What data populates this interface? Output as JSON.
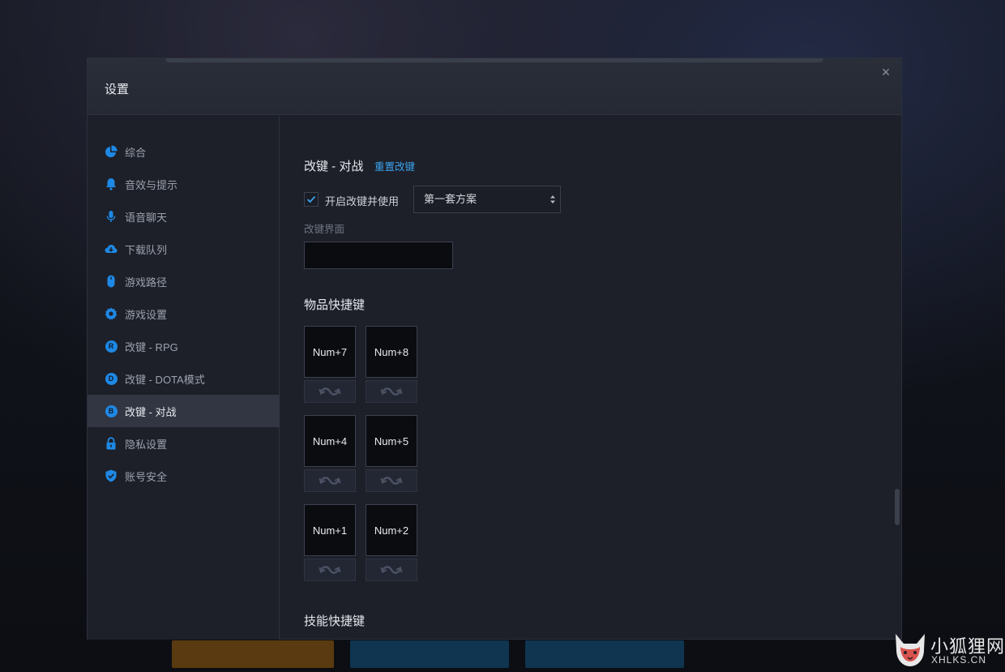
{
  "dialog": {
    "title": "设置",
    "close_label": "×"
  },
  "sidebar": {
    "items": [
      {
        "label": "综合",
        "icon": "pie-chart-icon"
      },
      {
        "label": "音效与提示",
        "icon": "bell-icon"
      },
      {
        "label": "语音聊天",
        "icon": "microphone-icon"
      },
      {
        "label": "下载队列",
        "icon": "cloud-download-icon"
      },
      {
        "label": "游戏路径",
        "icon": "mouse-icon"
      },
      {
        "label": "游戏设置",
        "icon": "gear-icon"
      },
      {
        "label": "改键 - RPG",
        "icon": "letter-r-icon",
        "badge": "R"
      },
      {
        "label": "改键 - DOTA模式",
        "icon": "letter-d-icon",
        "badge": "D"
      },
      {
        "label": "改键 - 对战",
        "icon": "letter-b-icon",
        "badge": "B",
        "active": true
      },
      {
        "label": "隐私设置",
        "icon": "lock-icon"
      },
      {
        "label": "账号安全",
        "icon": "shield-icon"
      }
    ]
  },
  "content": {
    "section_title": "改键 - 对战",
    "reset_link": "重置改键",
    "enable_label": "开启改键并使用",
    "enable_checked": true,
    "scheme_selected": "第一套方案",
    "interface_label": "改键界面",
    "interface_value": "",
    "items_title": "物品快捷键",
    "item_keys": [
      "Num+7",
      "Num+8",
      "Num+4",
      "Num+5",
      "Num+1",
      "Num+2"
    ],
    "skills_title": "技能快捷键"
  },
  "colors": {
    "accent": "#1e88e5",
    "link": "#3ca3f0",
    "panel": "#1d2029"
  },
  "watermark": {
    "line1": "小狐狸网",
    "line2": "XHLKS.CN"
  }
}
